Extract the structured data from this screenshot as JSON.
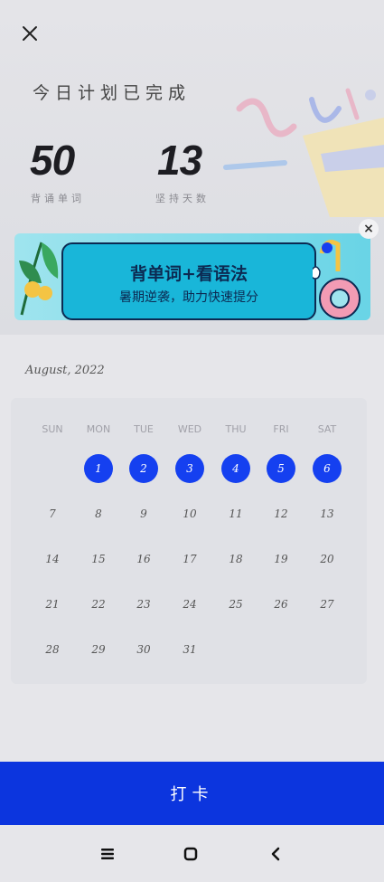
{
  "hero": {
    "title": "今日计划已完成",
    "stats": [
      {
        "value": "50",
        "label": "背诵单词"
      },
      {
        "value": "13",
        "label": "坚持天数"
      }
    ]
  },
  "banner": {
    "title": "背单词+看语法",
    "subtitle": "暑期逆袭，助力快速提分",
    "close_label": "×"
  },
  "calendar": {
    "month_label": "August, 2022",
    "weekdays": [
      "SUN",
      "MON",
      "TUE",
      "WED",
      "THU",
      "FRI",
      "SAT"
    ],
    "weeks": [
      [
        "",
        "1",
        "2",
        "3",
        "4",
        "5",
        "6"
      ],
      [
        "7",
        "8",
        "9",
        "10",
        "11",
        "12",
        "13"
      ],
      [
        "14",
        "15",
        "16",
        "17",
        "18",
        "19",
        "20"
      ],
      [
        "21",
        "22",
        "23",
        "24",
        "25",
        "26",
        "27"
      ],
      [
        "28",
        "29",
        "30",
        "31",
        "",
        "",
        ""
      ]
    ],
    "checked_days": [
      "1",
      "2",
      "3",
      "4",
      "5",
      "6"
    ]
  },
  "checkin_button": {
    "label": "打卡"
  },
  "colors": {
    "accent": "#0c35de",
    "checked": "#1540f0",
    "banner_text": "#0c2a52"
  },
  "icons": [
    "close-icon",
    "menu-icon",
    "home-icon",
    "back-icon"
  ]
}
